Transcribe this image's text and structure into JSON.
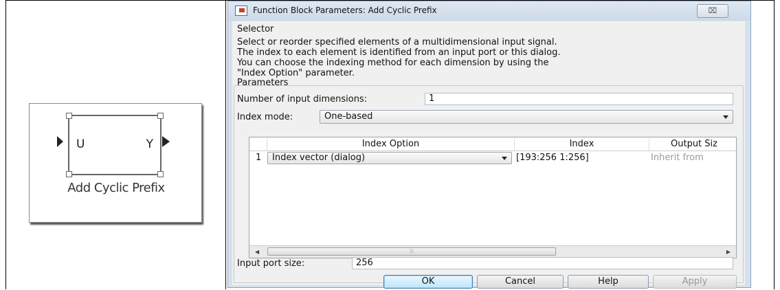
{
  "block": {
    "input_port": "U",
    "output_port": "Y",
    "name": "Add Cyclic Prefix"
  },
  "dialog": {
    "title": "Function Block Parameters: Add Cyclic Prefix",
    "close_glyph": "⌧",
    "section_title": "Selector",
    "description": "Select or reorder specified elements of a multidimensional input signal.\nThe index to each element is identified from an input port or this dialog.\nYou can choose the indexing method for each dimension by using the\n\"Index Option\" parameter.",
    "params_title": "Parameters",
    "num_dims_label": "Number of input dimensions:",
    "num_dims_value": "1",
    "index_mode_label": "Index mode:",
    "index_mode_value": "One-based",
    "table": {
      "columns": [
        "Index Option",
        "Index",
        "Output Siz"
      ],
      "rows": [
        {
          "num": "1",
          "option": "Index vector (dialog)",
          "index": "[193:256 1:256]",
          "output": "Inherit from"
        }
      ]
    },
    "input_port_size_label": "Input port size:",
    "input_port_size_value": "256",
    "buttons": {
      "ok": "OK",
      "cancel": "Cancel",
      "help": "Help",
      "apply": "Apply"
    }
  }
}
